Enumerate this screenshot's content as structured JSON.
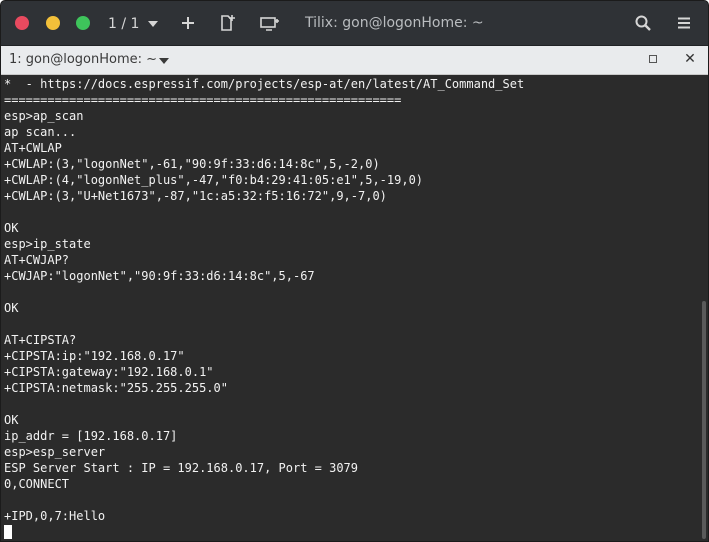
{
  "headerbar": {
    "session_counter": "1 / 1",
    "window_title": "Tilix: gon@logonHome: ~",
    "icons": {
      "close": "close-icon",
      "minimize": "minimize-icon",
      "maximize": "maximize-icon",
      "session_dropdown": "chevron-down-icon",
      "add_terminal": "plus-icon",
      "new_session": "add-session-icon",
      "sync_input": "sync-input-icon",
      "search": "search-icon",
      "menu": "hamburger-menu-icon"
    }
  },
  "terminal_tab": {
    "title": "1: gon@logonHome: ~",
    "icons": {
      "dropdown": "chevron-down-icon",
      "maximize": "maximize-pane-icon",
      "close": "close-icon"
    }
  },
  "terminal": {
    "lines": [
      "*  - https://docs.espressif.com/projects/esp-at/en/latest/AT_Command_Set",
      "=======================================================",
      "esp>ap_scan",
      "ap scan...",
      "AT+CWLAP",
      "+CWLAP:(3,\"logonNet\",-61,\"90:9f:33:d6:14:8c\",5,-2,0)",
      "+CWLAP:(4,\"logonNet_plus\",-47,\"f0:b4:29:41:05:e1\",5,-19,0)",
      "+CWLAP:(3,\"U+Net1673\",-87,\"1c:a5:32:f5:16:72\",9,-7,0)",
      "",
      "OK",
      "esp>ip_state",
      "AT+CWJAP?",
      "+CWJAP:\"logonNet\",\"90:9f:33:d6:14:8c\",5,-67",
      "",
      "OK",
      "",
      "AT+CIPSTA?",
      "+CIPSTA:ip:\"192.168.0.17\"",
      "+CIPSTA:gateway:\"192.168.0.1\"",
      "+CIPSTA:netmask:\"255.255.255.0\"",
      "",
      "OK",
      "ip_addr = [192.168.0.17]",
      "esp>esp_server",
      "ESP Server Start : IP = 192.168.0.17, Port = 3079",
      "0,CONNECT",
      "",
      "+IPD,0,7:Hello"
    ]
  },
  "colors": {
    "headerbar_bg": "#2f3236",
    "terminal_bg": "#2b2b2b",
    "terminal_fg": "#f2f2f2",
    "close_button": "#e84a5f",
    "minimize_button": "#f3c03a",
    "maximize_button": "#3ec45b"
  }
}
